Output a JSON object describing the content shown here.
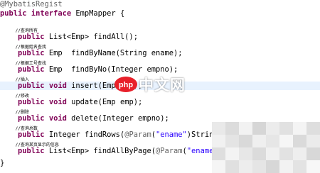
{
  "editor": {
    "lines": [
      {
        "segments": [
          {
            "cls": "anno",
            "text": "@MybatisRegist"
          }
        ]
      },
      {
        "segments": [
          {
            "cls": "kw",
            "text": "public"
          },
          {
            "cls": "ident",
            "text": " "
          },
          {
            "cls": "kw",
            "text": "interface"
          },
          {
            "cls": "ident",
            "text": " EmpMapper {"
          }
        ]
      },
      {
        "segments": []
      },
      {
        "comment": true,
        "segments": [
          {
            "cls": "ident",
            "text": "      //查询所有"
          }
        ]
      },
      {
        "segments": [
          {
            "cls": "ident",
            "text": "    "
          },
          {
            "cls": "kw",
            "text": "public"
          },
          {
            "cls": "ident",
            "text": " List<Emp> findAll();"
          }
        ]
      },
      {
        "comment": true,
        "segments": [
          {
            "cls": "ident",
            "text": "      //根据姓名查找"
          }
        ]
      },
      {
        "segments": [
          {
            "cls": "ident",
            "text": "    "
          },
          {
            "cls": "kw",
            "text": "public"
          },
          {
            "cls": "ident",
            "text": " Emp  findByName(String ename);"
          }
        ]
      },
      {
        "comment": true,
        "segments": [
          {
            "cls": "ident",
            "text": "      //根据工号查找"
          }
        ]
      },
      {
        "segments": [
          {
            "cls": "ident",
            "text": "    "
          },
          {
            "cls": "kw",
            "text": "public"
          },
          {
            "cls": "ident",
            "text": " Emp  findByNo(Integer empno);"
          }
        ]
      },
      {
        "comment": true,
        "segments": [
          {
            "cls": "ident",
            "text": "      //插入"
          }
        ]
      },
      {
        "highlight": true,
        "segments": [
          {
            "cls": "ident",
            "text": "    "
          },
          {
            "cls": "kw",
            "text": "public"
          },
          {
            "cls": "ident",
            "text": " "
          },
          {
            "cls": "kw",
            "text": "void"
          },
          {
            "cls": "ident",
            "text": " insert(Emp emp);"
          }
        ]
      },
      {
        "comment": true,
        "segments": [
          {
            "cls": "ident",
            "text": "      //修改"
          }
        ]
      },
      {
        "segments": [
          {
            "cls": "ident",
            "text": "    "
          },
          {
            "cls": "kw",
            "text": "public"
          },
          {
            "cls": "ident",
            "text": " "
          },
          {
            "cls": "kw",
            "text": "void"
          },
          {
            "cls": "ident",
            "text": " update(Emp emp);"
          }
        ]
      },
      {
        "comment": true,
        "segments": [
          {
            "cls": "ident",
            "text": "      //删除"
          }
        ]
      },
      {
        "segments": [
          {
            "cls": "ident",
            "text": "    "
          },
          {
            "cls": "kw",
            "text": "public"
          },
          {
            "cls": "ident",
            "text": " "
          },
          {
            "cls": "kw",
            "text": "void"
          },
          {
            "cls": "ident",
            "text": " delete(Integer empno);"
          }
        ]
      },
      {
        "comment": true,
        "segments": [
          {
            "cls": "ident",
            "text": "      //查询总数"
          }
        ]
      },
      {
        "segments": [
          {
            "cls": "ident",
            "text": "    "
          },
          {
            "cls": "kw",
            "text": "public"
          },
          {
            "cls": "ident",
            "text": " Integer findRows("
          },
          {
            "cls": "anno",
            "text": "@Param"
          },
          {
            "cls": "ident",
            "text": "("
          },
          {
            "cls": "str",
            "text": "\"ename\""
          },
          {
            "cls": "ident",
            "text": ")String"
          }
        ]
      },
      {
        "comment": true,
        "segments": [
          {
            "cls": "ident",
            "text": "      //查询某页显示的信息"
          }
        ]
      },
      {
        "segments": [
          {
            "cls": "ident",
            "text": "    "
          },
          {
            "cls": "kw",
            "text": "public"
          },
          {
            "cls": "ident",
            "text": " List<Emp> findAllByPage("
          },
          {
            "cls": "anno",
            "text": "@Param"
          },
          {
            "cls": "ident",
            "text": "("
          },
          {
            "cls": "str",
            "text": "\"ename\""
          }
        ]
      },
      {
        "segments": []
      },
      {
        "segments": [
          {
            "cls": "ident",
            "text": "}"
          }
        ]
      }
    ]
  },
  "watermark": {
    "text": "中文网",
    "badge": "php"
  },
  "mosaic": [
    "#e9e9e9",
    "#dcdcdc",
    "#f2f2f2",
    "#d6d6d6",
    "#ececec",
    "#e1e1e1",
    "#f4f4f4",
    "#dedede",
    "#f1f1f1",
    "#e4e4e4",
    "#d9d9d9",
    "#efefef",
    "#e6e6e6",
    "#f6f6f6",
    "#dadada",
    "#ebebeb",
    "#dedede",
    "#f3f3f3",
    "#e7e7e7",
    "#dbdbdb",
    "#f0f0f0",
    "#e2e2e2",
    "#eeeeee",
    "#d8d8d8",
    "#f5f5f5",
    "#e0e0e0",
    "#ededed",
    "#e5e5e5",
    "#d7d7d7",
    "#f2f2f2",
    "#e3e3e3",
    "#f7f7f7"
  ]
}
